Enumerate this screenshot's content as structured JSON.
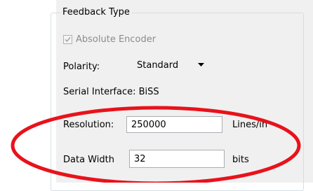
{
  "group": {
    "title": "Feedback Type"
  },
  "absolute_encoder": {
    "label": "Absolute Encoder",
    "checked": true,
    "disabled": true
  },
  "polarity": {
    "label": "Polarity:",
    "value": "Standard"
  },
  "serial_interface": {
    "text": "Serial Interface: BiSS"
  },
  "resolution": {
    "label": "Resolution:",
    "value": "250000",
    "unit": "Lines/in"
  },
  "data_width": {
    "label": "Data Width",
    "value": "32",
    "unit": "bits"
  },
  "colors": {
    "annotation": "#e8121b",
    "panel_background": "#f0f0f0",
    "disabled_text": "#8c8c8c"
  }
}
